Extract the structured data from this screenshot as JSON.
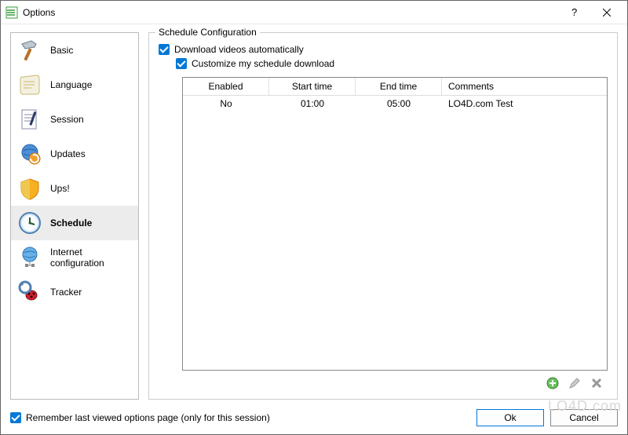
{
  "window": {
    "title": "Options"
  },
  "sidebar": {
    "items": [
      {
        "label": "Basic"
      },
      {
        "label": "Language"
      },
      {
        "label": "Session"
      },
      {
        "label": "Updates"
      },
      {
        "label": "Ups!"
      },
      {
        "label": "Schedule"
      },
      {
        "label": "Internet configuration"
      },
      {
        "label": "Tracker"
      }
    ]
  },
  "group": {
    "title": "Schedule Configuration",
    "download_auto": "Download videos automatically",
    "customize": "Customize my schedule download"
  },
  "table": {
    "headers": {
      "enabled": "Enabled",
      "start": "Start time",
      "end": "End time",
      "comments": "Comments"
    },
    "rows": [
      {
        "enabled": "No",
        "start": "01:00",
        "end": "05:00",
        "comments": "LO4D.com Test"
      }
    ]
  },
  "footer": {
    "remember": "Remember last viewed options page (only for this session)",
    "ok": "Ok",
    "cancel": "Cancel"
  },
  "watermark": "LO4D.com"
}
